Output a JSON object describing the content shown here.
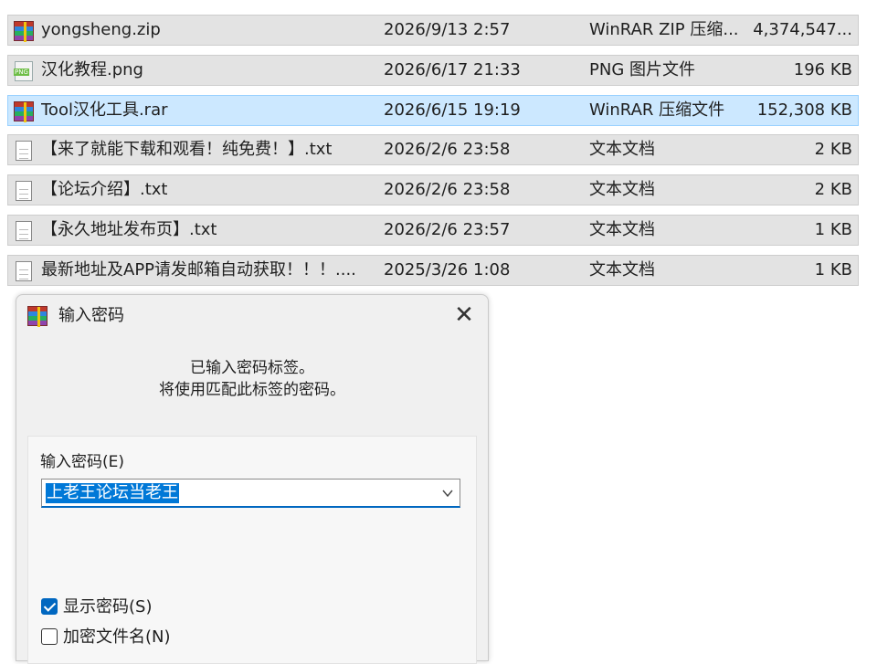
{
  "files": [
    {
      "icon": "rar-icon",
      "name": "yongsheng.zip",
      "date": "2026/9/13 2:57",
      "type": "WinRAR ZIP 压缩...",
      "size": "4,374,547...",
      "selected": false
    },
    {
      "icon": "png-icon",
      "name": "汉化教程.png",
      "date": "2026/6/17 21:33",
      "type": "PNG 图片文件",
      "size": "196 KB",
      "selected": false
    },
    {
      "icon": "rar-icon",
      "name": "Tool汉化工具.rar",
      "date": "2026/6/15 19:19",
      "type": "WinRAR 压缩文件",
      "size": "152,308 KB",
      "selected": true
    },
    {
      "icon": "txt-icon",
      "name": "【来了就能下载和观看！纯免费！】.txt",
      "date": "2026/2/6 23:58",
      "type": "文本文档",
      "size": "2 KB",
      "selected": false
    },
    {
      "icon": "txt-icon",
      "name": "【论坛介绍】.txt",
      "date": "2026/2/6 23:58",
      "type": "文本文档",
      "size": "2 KB",
      "selected": false
    },
    {
      "icon": "txt-icon",
      "name": "【永久地址发布页】.txt",
      "date": "2026/2/6 23:57",
      "type": "文本文档",
      "size": "1 KB",
      "selected": false
    },
    {
      "icon": "txt-icon",
      "name": "最新地址及APP请发邮箱自动获取！！！....",
      "date": "2025/3/26 1:08",
      "type": "文本文档",
      "size": "1 KB",
      "selected": false
    }
  ],
  "dialog": {
    "title": "输入密码",
    "close_symbol": "✕",
    "message_line1": "已输入密码标签。",
    "message_line2": "将使用匹配此标签的密码。",
    "password_label": "输入密码(E)",
    "password_value": "上老王论坛当老王",
    "show_password_label": "显示密码(S)",
    "show_password_checked": true,
    "encrypt_names_label": "加密文件名(N)",
    "encrypt_names_checked": false
  }
}
